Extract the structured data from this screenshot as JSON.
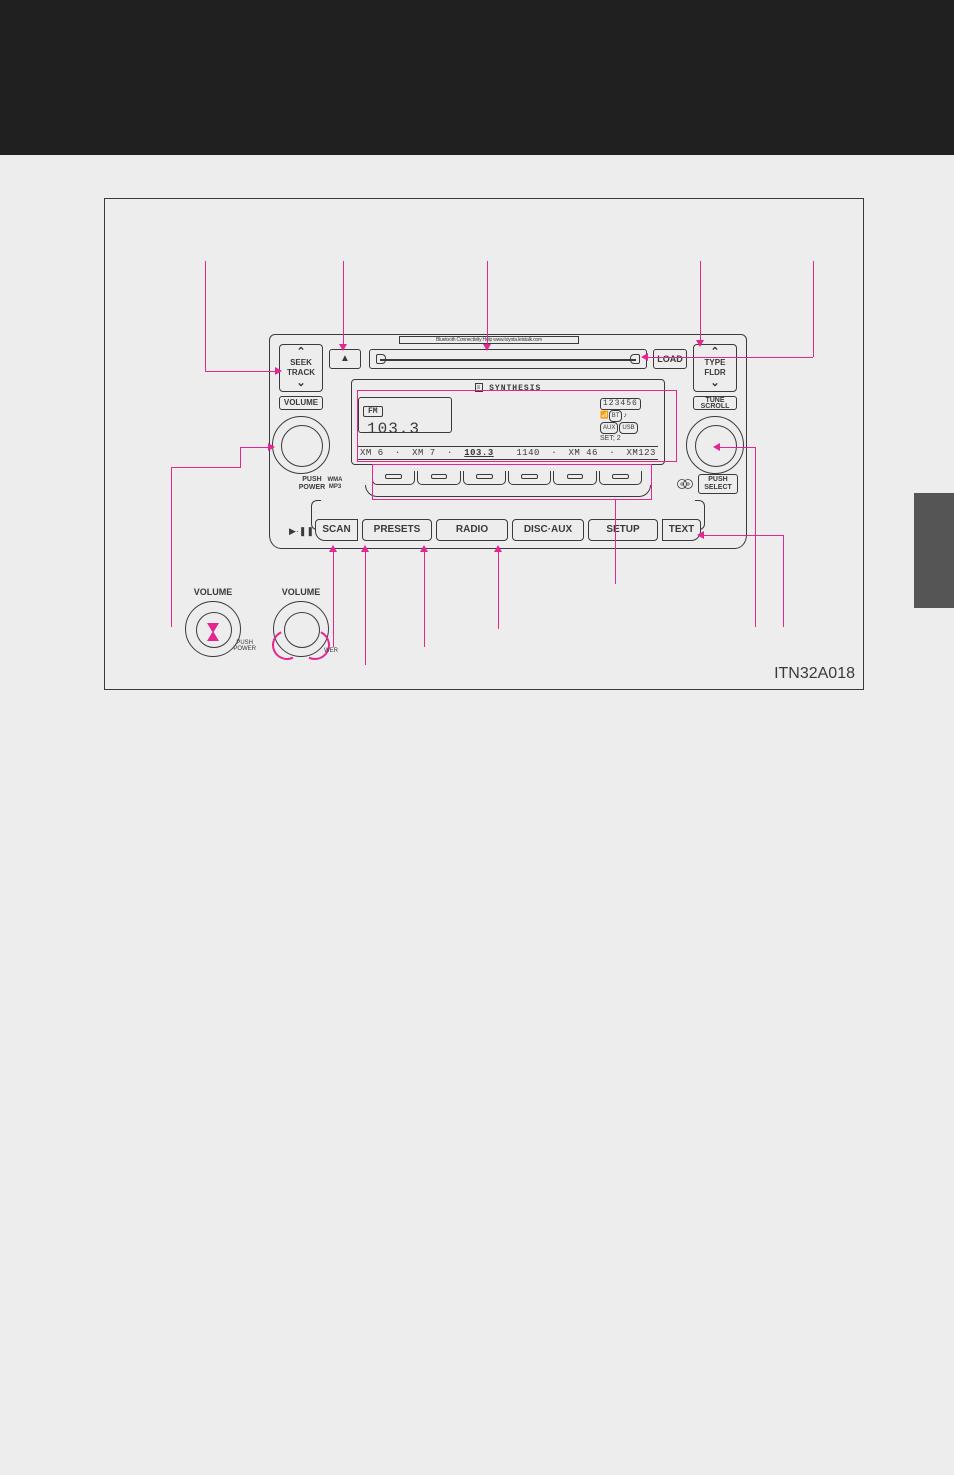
{
  "diagram_id": "ITN32A018",
  "bt_help_text": "Bluetooth Connectivity Help   www.toyota.letstalk.com",
  "left_col": {
    "seek_l1": "SEEK",
    "seek_l2": "TRACK",
    "volume": "VOLUME",
    "push": "PUSH",
    "power": "POWER",
    "wma_l1": "WMA",
    "wma_l2": "MP3",
    "play_pause": "▶·❚❚"
  },
  "right_col": {
    "type_l1": "TYPE",
    "type_l2": "FLDR",
    "tune": "TUNE",
    "scroll": "SCROLL",
    "push": "PUSH",
    "select": "SELECT"
  },
  "top_row": {
    "eject": "▲",
    "load": "LOAD"
  },
  "screen": {
    "title": "SYNTHESIS",
    "band": "FM",
    "freq": "103.3",
    "digits": "123456",
    "aux": "AUX",
    "usb": "USB",
    "bt": "BT",
    "set_label": "SET;",
    "set_val": "2",
    "presets": {
      "p1": "XM 6",
      "p2": "XM 7",
      "p3_cur": "103.3",
      "p4": "1140",
      "p5": "XM 46",
      "p6": "XM123"
    }
  },
  "buttons": {
    "scan": "SCAN",
    "presets": "PRESETS",
    "radio": "RADIO",
    "disc_aux": "DISC·AUX",
    "setup": "SETUP",
    "text": "TEXT"
  },
  "insets": {
    "volume": "VOLUME",
    "push": "PUSH",
    "power": "POWER",
    "wer_frag": "WER"
  }
}
